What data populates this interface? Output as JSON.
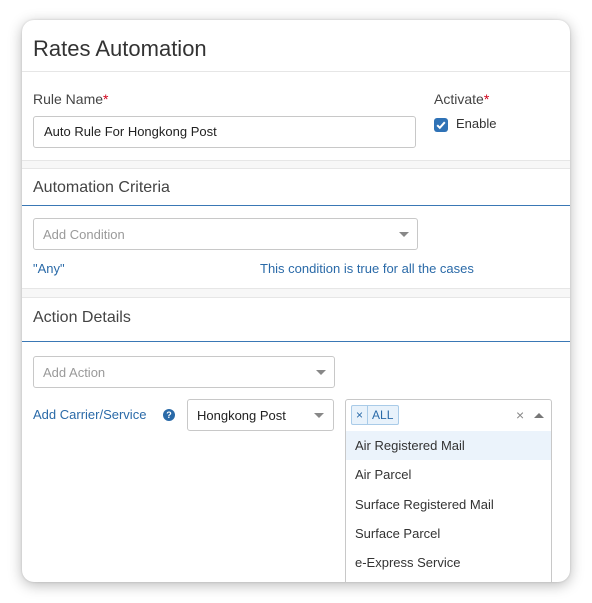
{
  "page": {
    "title": "Rates Automation"
  },
  "rule": {
    "name_label": "Rule Name",
    "name_value": "Auto Rule For Hongkong Post",
    "activate_label": "Activate",
    "enable_label": "Enable",
    "enabled": true,
    "required_mark": "*"
  },
  "criteria": {
    "title": "Automation Criteria",
    "condition_placeholder": "Add Condition",
    "any_text": "\"Any\"",
    "any_description": "This condition is true for all the cases"
  },
  "action": {
    "title": "Action Details",
    "action_placeholder": "Add Action",
    "carrier_label": "Add Carrier/Service",
    "carrier_value": "Hongkong Post",
    "selected_tag": "ALL",
    "tag_remove": "×",
    "clear_symbol": "×",
    "options": [
      "Air Registered Mail",
      "Air Parcel",
      "Surface Registered Mail",
      "Surface Parcel",
      "e-Express Service"
    ],
    "highlighted_option": "Air Registered Mail"
  },
  "colors": {
    "accent": "#2a6aa8",
    "required": "#d0021b",
    "checkbox": "#2f72b6"
  }
}
